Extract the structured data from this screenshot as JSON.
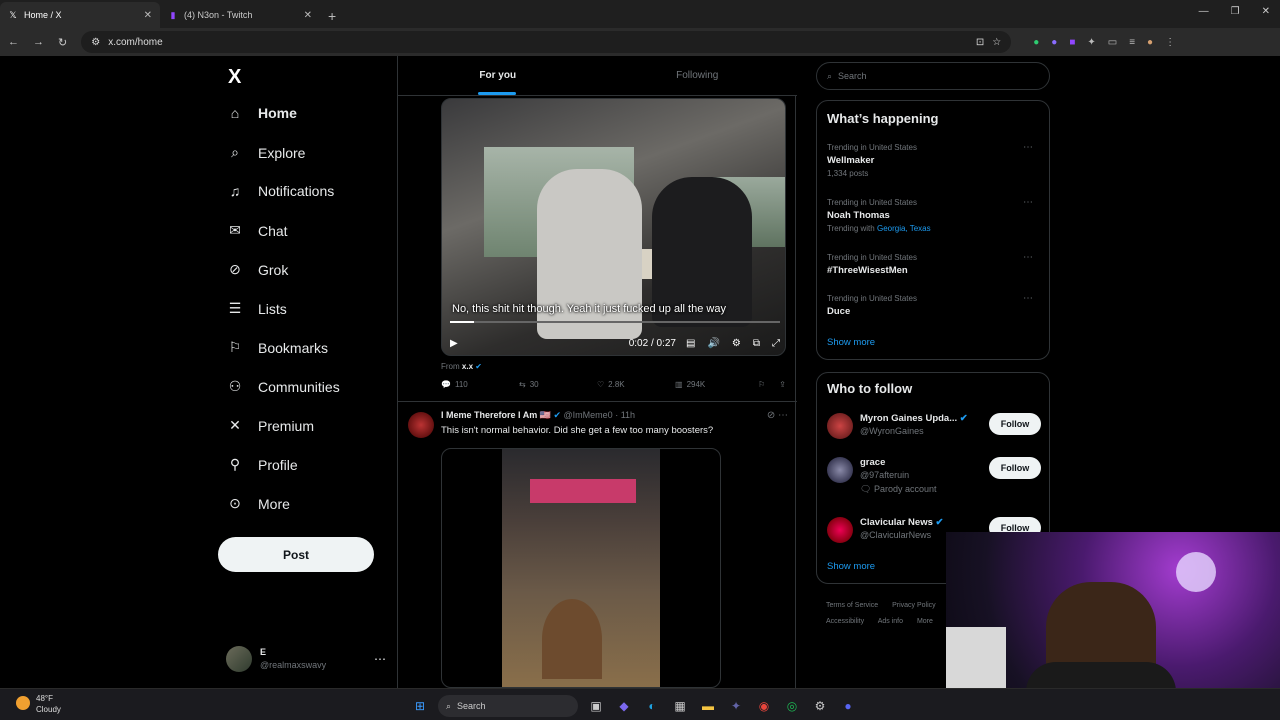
{
  "browser": {
    "tabs": [
      {
        "label": "Home / X",
        "icon": "x-logo-icon",
        "active": true
      },
      {
        "label": "(4) N3on - Twitch",
        "icon": "twitch-icon",
        "active": false
      }
    ],
    "url": "x.com/home"
  },
  "nav": {
    "logo": "X",
    "items": [
      {
        "label": "Home",
        "icon": "home-icon",
        "glyph": "⌂",
        "active": true
      },
      {
        "label": "Explore",
        "icon": "search-icon",
        "glyph": "⌕"
      },
      {
        "label": "Notifications",
        "icon": "bell-icon",
        "glyph": "🔔"
      },
      {
        "label": "Chat",
        "icon": "mail-icon",
        "glyph": "✉"
      },
      {
        "label": "Grok",
        "icon": "grok-icon",
        "glyph": "⊘"
      },
      {
        "label": "Lists",
        "icon": "list-icon",
        "glyph": "☰"
      },
      {
        "label": "Bookmarks",
        "icon": "bookmark-icon",
        "glyph": "🔖"
      },
      {
        "label": "Communities",
        "icon": "communities-icon",
        "glyph": "👥"
      },
      {
        "label": "Premium",
        "icon": "x-premium-icon",
        "glyph": "✕"
      },
      {
        "label": "Profile",
        "icon": "profile-icon",
        "glyph": "👤"
      },
      {
        "label": "More",
        "icon": "more-circle-icon",
        "glyph": "⋯"
      }
    ],
    "post_label": "Post",
    "account": {
      "name": "E",
      "handle": "@realmaxswavy"
    }
  },
  "feed": {
    "tabs": [
      "For you",
      "Following"
    ],
    "post1": {
      "caption": "No, this shit hit though. Yeah it just fucked up all the way",
      "time": "0:02 / 0:27",
      "progress": 0.074,
      "from_label": "From",
      "from_name": "x.x",
      "replies": "110",
      "reposts": "30",
      "likes": "2.8K",
      "views": "294K"
    },
    "post2": {
      "author": "I Meme Therefore I Am",
      "flag": "🇺🇸",
      "handle": "@ImMeme0",
      "time": "11h",
      "text": "This isn't normal behavior. Did she get a few too many boosters?"
    }
  },
  "right": {
    "search_placeholder": "Search",
    "happening_title": "What’s happening",
    "trends": [
      {
        "context": "Trending in United States",
        "name": "Wellmaker",
        "sub": "1,334 posts"
      },
      {
        "context": "Trending in United States",
        "name": "Noah Thomas",
        "sub_prefix": "Trending with",
        "sub_link": "Georgia, Texas"
      },
      {
        "context": "Trending in United States",
        "name": "#ThreeWisestMen"
      },
      {
        "context": "Trending in United States",
        "name": "Duce"
      }
    ],
    "show_more": "Show more",
    "who_title": "Who to follow",
    "who": [
      {
        "name": "Myron Gaines Upda...",
        "handle": "@WyronGaines",
        "verified": true,
        "button": "Follow"
      },
      {
        "name": "grace",
        "handle": "@97afteruin",
        "extra": "Parody account",
        "button": "Follow"
      },
      {
        "name": "Clavicular News",
        "handle": "@ClavicularNews",
        "verified": true,
        "button": "Follow"
      }
    ],
    "footer": [
      "Terms of Service",
      "Privacy Policy",
      "Accessibility",
      "Ads info",
      "More"
    ]
  },
  "taskbar": {
    "temp": "48°F",
    "condition": "Cloudy",
    "search": "Search"
  }
}
